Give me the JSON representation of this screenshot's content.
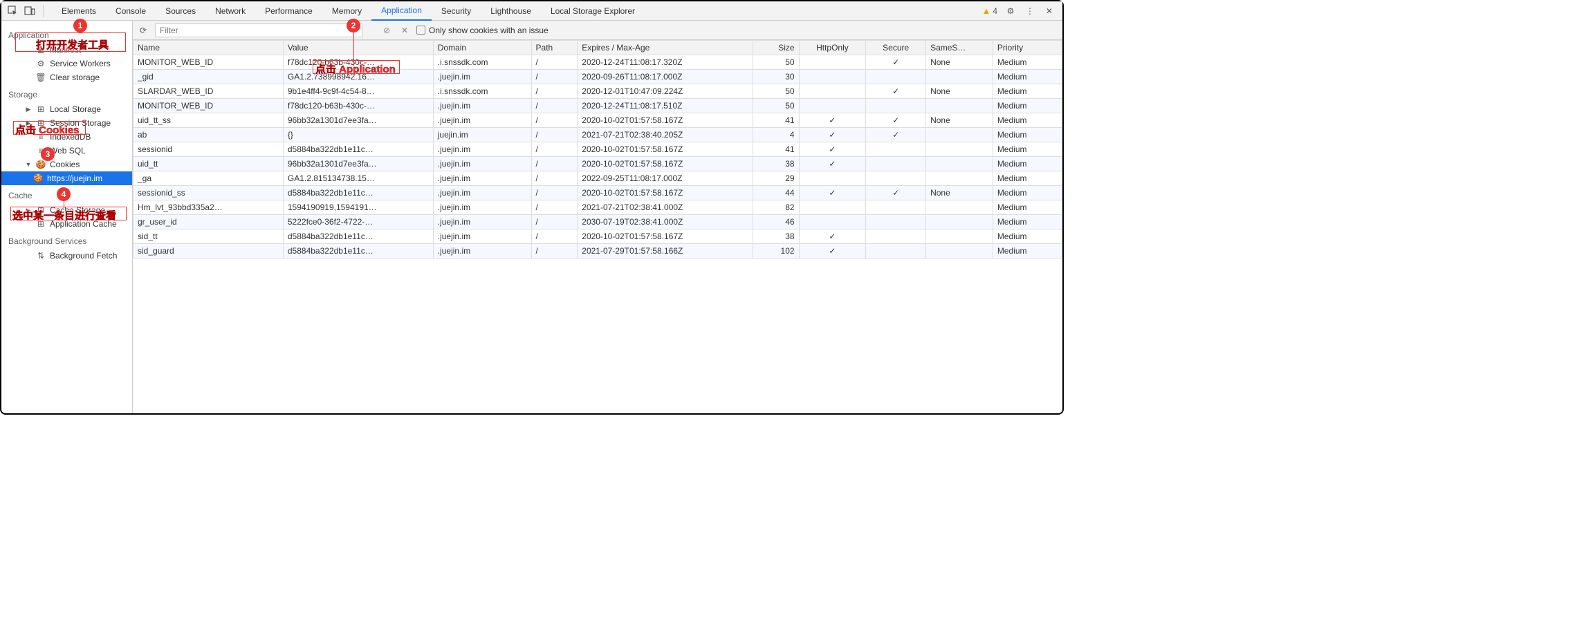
{
  "toolbar": {
    "tabs": [
      "Elements",
      "Console",
      "Sources",
      "Network",
      "Performance",
      "Memory",
      "Application",
      "Security",
      "Lighthouse",
      "Local Storage Explorer"
    ],
    "active_tab": 6,
    "warning_count": "4"
  },
  "sidebar": {
    "groups": [
      {
        "title": "Application",
        "items": [
          {
            "label": "Manifest",
            "icon": "file"
          },
          {
            "label": "Service Workers",
            "icon": "gear"
          },
          {
            "label": "Clear storage",
            "icon": "trash"
          }
        ]
      },
      {
        "title": "Storage",
        "items": [
          {
            "label": "Local Storage",
            "icon": "db-grid",
            "tri": "▶"
          },
          {
            "label": "Session Storage",
            "icon": "db-grid",
            "tri": "▶"
          },
          {
            "label": "IndexedDB",
            "icon": "db"
          },
          {
            "label": "Web SQL",
            "icon": "db"
          },
          {
            "label": "Cookies",
            "icon": "cookie",
            "tri": "▼",
            "children": [
              {
                "label": "https://juejin.im",
                "icon": "cookie",
                "selected": true
              }
            ]
          }
        ]
      },
      {
        "title": "Cache",
        "items": [
          {
            "label": "Cache Storage",
            "icon": "db-grid",
            "tri": "▶"
          },
          {
            "label": "Application Cache",
            "icon": "db-grid"
          }
        ]
      },
      {
        "title": "Background Services",
        "items": [
          {
            "label": "Background Fetch",
            "icon": "updown"
          }
        ]
      }
    ]
  },
  "filterbar": {
    "placeholder": "Filter",
    "only_issue_label": "Only show cookies with an issue"
  },
  "table": {
    "headers": [
      "Name",
      "Value",
      "Domain",
      "Path",
      "Expires / Max-Age",
      "Size",
      "HttpOnly",
      "Secure",
      "SameS…",
      "Priority"
    ],
    "rows": [
      {
        "name": "MONITOR_WEB_ID",
        "value": "f78dc120-b63b-430c-…",
        "domain": ".i.snssdk.com",
        "path": "/",
        "exp": "2020-12-24T11:08:17.320Z",
        "size": "50",
        "ho": "",
        "sec": "✓",
        "ss": "None",
        "pri": "Medium"
      },
      {
        "name": "_gid",
        "value": "GA1.2.738998942.16…",
        "domain": ".juejin.im",
        "path": "/",
        "exp": "2020-09-26T11:08:17.000Z",
        "size": "30",
        "ho": "",
        "sec": "",
        "ss": "",
        "pri": "Medium"
      },
      {
        "name": "SLARDAR_WEB_ID",
        "value": "9b1e4ff4-9c9f-4c54-8…",
        "domain": ".i.snssdk.com",
        "path": "/",
        "exp": "2020-12-01T10:47:09.224Z",
        "size": "50",
        "ho": "",
        "sec": "✓",
        "ss": "None",
        "pri": "Medium"
      },
      {
        "name": "MONITOR_WEB_ID",
        "value": "f78dc120-b63b-430c-…",
        "domain": ".juejin.im",
        "path": "/",
        "exp": "2020-12-24T11:08:17.510Z",
        "size": "50",
        "ho": "",
        "sec": "",
        "ss": "",
        "pri": "Medium"
      },
      {
        "name": "uid_tt_ss",
        "value": "96bb32a1301d7ee3fa…",
        "domain": ".juejin.im",
        "path": "/",
        "exp": "2020-10-02T01:57:58.167Z",
        "size": "41",
        "ho": "✓",
        "sec": "✓",
        "ss": "None",
        "pri": "Medium"
      },
      {
        "name": "ab",
        "value": "{}",
        "domain": "juejin.im",
        "path": "/",
        "exp": "2021-07-21T02:38:40.205Z",
        "size": "4",
        "ho": "✓",
        "sec": "✓",
        "ss": "",
        "pri": "Medium"
      },
      {
        "name": "sessionid",
        "value": "d5884ba322db1e11c…",
        "domain": ".juejin.im",
        "path": "/",
        "exp": "2020-10-02T01:57:58.167Z",
        "size": "41",
        "ho": "✓",
        "sec": "",
        "ss": "",
        "pri": "Medium"
      },
      {
        "name": "uid_tt",
        "value": "96bb32a1301d7ee3fa…",
        "domain": ".juejin.im",
        "path": "/",
        "exp": "2020-10-02T01:57:58.167Z",
        "size": "38",
        "ho": "✓",
        "sec": "",
        "ss": "",
        "pri": "Medium"
      },
      {
        "name": "_ga",
        "value": "GA1.2.815134738.15…",
        "domain": ".juejin.im",
        "path": "/",
        "exp": "2022-09-25T11:08:17.000Z",
        "size": "29",
        "ho": "",
        "sec": "",
        "ss": "",
        "pri": "Medium"
      },
      {
        "name": "sessionid_ss",
        "value": "d5884ba322db1e11c…",
        "domain": ".juejin.im",
        "path": "/",
        "exp": "2020-10-02T01:57:58.167Z",
        "size": "44",
        "ho": "✓",
        "sec": "✓",
        "ss": "None",
        "pri": "Medium"
      },
      {
        "name": "Hm_lvt_93bbd335a2…",
        "value": "1594190919,1594191…",
        "domain": ".juejin.im",
        "path": "/",
        "exp": "2021-07-21T02:38:41.000Z",
        "size": "82",
        "ho": "",
        "sec": "",
        "ss": "",
        "pri": "Medium"
      },
      {
        "name": "gr_user_id",
        "value": "5222fce0-36f2-4722-…",
        "domain": ".juejin.im",
        "path": "/",
        "exp": "2030-07-19T02:38:41.000Z",
        "size": "46",
        "ho": "",
        "sec": "",
        "ss": "",
        "pri": "Medium"
      },
      {
        "name": "sid_tt",
        "value": "d5884ba322db1e11c…",
        "domain": ".juejin.im",
        "path": "/",
        "exp": "2020-10-02T01:57:58.167Z",
        "size": "38",
        "ho": "✓",
        "sec": "",
        "ss": "",
        "pri": "Medium"
      },
      {
        "name": "sid_guard",
        "value": "d5884ba322db1e11c…",
        "domain": ".juejin.im",
        "path": "/",
        "exp": "2021-07-29T01:57:58.166Z",
        "size": "102",
        "ho": "✓",
        "sec": "",
        "ss": "",
        "pri": "Medium"
      }
    ]
  },
  "annotations": {
    "a1": {
      "num": "1",
      "text": "打开开发者工具"
    },
    "a2": {
      "num": "2",
      "text": "点击 Application"
    },
    "a3": {
      "num": "3",
      "text": "点击 Cookies"
    },
    "a4": {
      "num": "4",
      "text": "选中某一条目进行查看"
    }
  }
}
